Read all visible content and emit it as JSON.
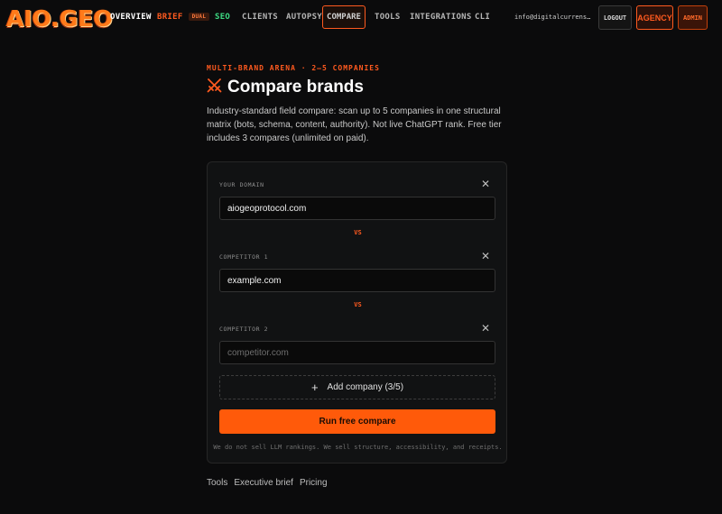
{
  "nav": {
    "logo": "AIO.GEO",
    "items": {
      "overview": "OVERVIEW",
      "brief": "BRIEF",
      "brief_badge": "DUAL",
      "seo": "SEO",
      "clients": "CLIENTS",
      "autopsy": "AUTOPSY",
      "compare": "COMPARE",
      "tools": "TOOLS",
      "integrations": "INTEGRATIONS",
      "cli": "CLI"
    },
    "email": "info@digitalcurrensy.c…",
    "logout": "LOGOUT",
    "agency": "AGENCY",
    "admin": "ADMIN"
  },
  "header": {
    "eyebrow": "MULTI-BRAND ARENA · 2–5 COMPANIES",
    "title": "Compare brands",
    "description": "Industry-standard field compare: scan up to 5 companies in one structural matrix (bots, schema, content, authority). Not live ChatGPT rank. Free tier includes 3 compares (unlimited on paid)."
  },
  "form": {
    "fields": [
      {
        "label": "YOUR DOMAIN",
        "value": "aiogeoprotocol.com",
        "placeholder": ""
      },
      {
        "label": "COMPETITOR 1",
        "value": "example.com",
        "placeholder": ""
      },
      {
        "label": "COMPETITOR 2",
        "value": "",
        "placeholder": "competitor.com"
      }
    ],
    "vs_label": "VS",
    "add_company": "Add company (3/5)",
    "run_button": "Run free compare",
    "disclaimer": "We do not sell LLM rankings. We sell structure, accessibility, and receipts."
  },
  "footer": {
    "links": [
      "Tools",
      "Executive brief",
      "Pricing"
    ]
  },
  "colors": {
    "accent": "#ff5a1f",
    "seo": "#3ddc84",
    "background": "#0b0b0c"
  }
}
